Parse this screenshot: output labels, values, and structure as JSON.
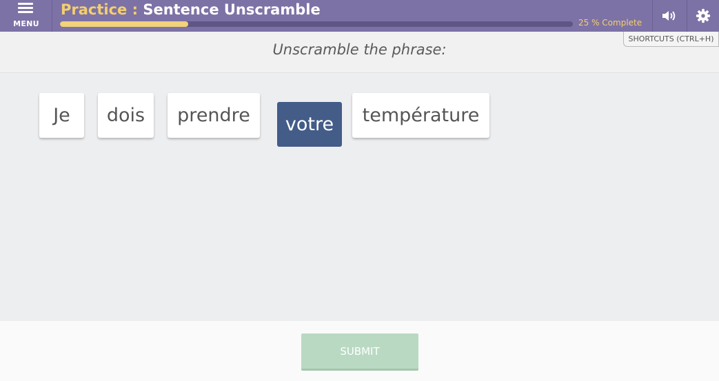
{
  "header": {
    "menu_label": "MENU",
    "title_prefix": "Practice :",
    "title_main": " Sentence Unscramble",
    "progress_percent": 25,
    "progress_text": "25 % Complete",
    "sound_icon": "speaker-icon",
    "settings_icon": "gear-icon",
    "shortcuts_label": "SHORTCUTS (CTRL+H)"
  },
  "colors": {
    "header_bg": "#7d72a6",
    "accent_yellow": "#f3cf6d",
    "selected_tile": "#435c88",
    "submit_bg": "#b9d9c3"
  },
  "instruction": "Unscramble the phrase:",
  "tiles": [
    {
      "word": "Je",
      "selected": false
    },
    {
      "word": "dois",
      "selected": false
    },
    {
      "word": "prendre",
      "selected": false
    },
    {
      "word": "votre",
      "selected": true
    },
    {
      "word": "température",
      "selected": false
    }
  ],
  "footer": {
    "submit_label": "SUBMIT"
  }
}
